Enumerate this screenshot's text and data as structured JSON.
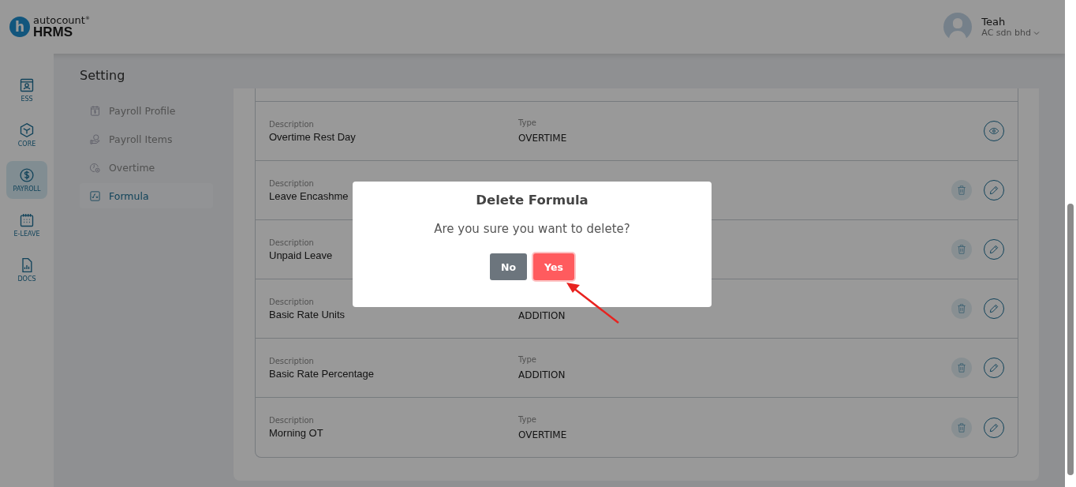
{
  "header": {
    "logo_mark": "h",
    "logo_brand": "autocount",
    "logo_registered": "®",
    "logo_product": "HRMS",
    "user_name": "Teah",
    "company": "AC sdn bhd"
  },
  "nav": [
    {
      "label": "ESS",
      "selected": false
    },
    {
      "label": "CORE",
      "selected": false
    },
    {
      "label": "PAYROLL",
      "selected": true
    },
    {
      "label": "E-LEAVE",
      "selected": false
    },
    {
      "label": "DOCS",
      "selected": false
    }
  ],
  "settings": {
    "title": "Setting",
    "items": [
      {
        "label": "Payroll Profile",
        "selected": false
      },
      {
        "label": "Payroll Items",
        "selected": false
      },
      {
        "label": "Overtime",
        "selected": false
      },
      {
        "label": "Formula",
        "selected": true
      }
    ]
  },
  "formulas": [
    {
      "description_label": "Description",
      "description": "Overtime Rest Day",
      "type_label": "Type",
      "type": "OVERTIME",
      "kind": "view"
    },
    {
      "description_label": "Description",
      "description": "Leave Encashme",
      "kind": "edit"
    },
    {
      "description_label": "Description",
      "description": "Unpaid Leave",
      "kind": "edit"
    },
    {
      "description_label": "Description",
      "description": "Basic Rate Units",
      "type": "ADDITION",
      "kind": "edit"
    },
    {
      "description_label": "Description",
      "description": "Basic Rate Percentage",
      "type_label": "Type",
      "type": "ADDITION",
      "kind": "edit"
    },
    {
      "description_label": "Description",
      "description": "Morning OT",
      "type_label": "Type",
      "type": "OVERTIME",
      "kind": "edit"
    }
  ],
  "dialog": {
    "title": "Delete Formula",
    "message": "Are you sure you want to delete?",
    "buttons": [
      {
        "label": "No",
        "kind": "cancel"
      },
      {
        "label": "Yes",
        "kind": "confirm"
      }
    ]
  }
}
